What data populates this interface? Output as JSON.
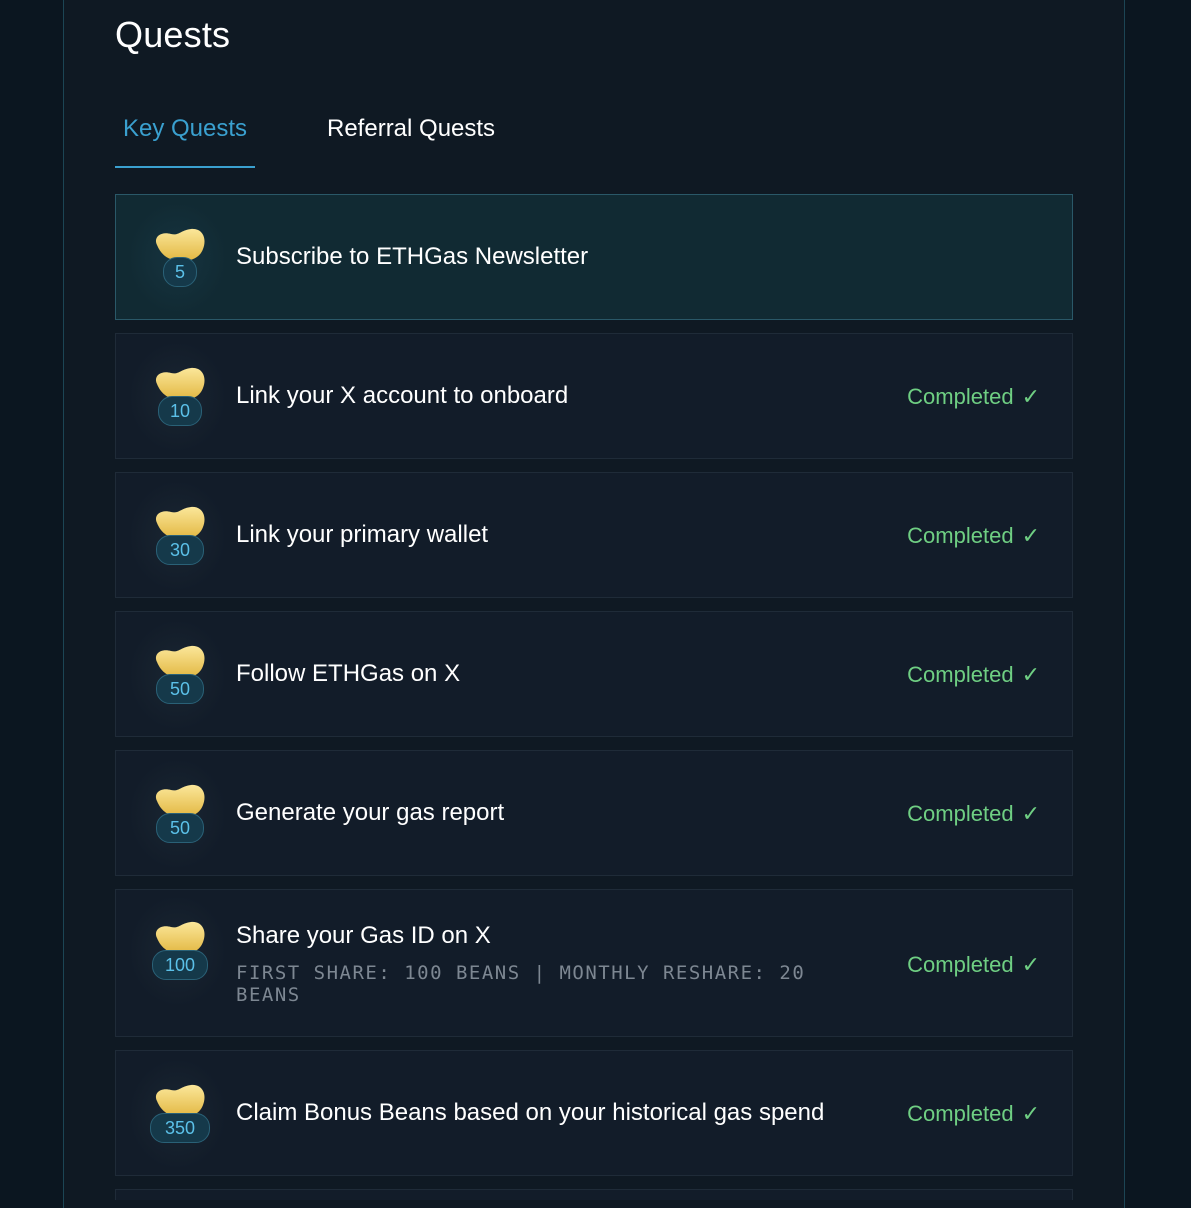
{
  "page_title": "Quests",
  "tabs": [
    {
      "label": "Key Quests",
      "active": true
    },
    {
      "label": "Referral Quests",
      "active": false
    }
  ],
  "colors": {
    "accent": "#3aa0cf",
    "completed": "#6fcf83",
    "bean": "#f3d26a"
  },
  "quests": [
    {
      "points": "5",
      "title": "Subscribe to ETHGas Newsletter",
      "subtitle": "",
      "status": ""
    },
    {
      "points": "10",
      "title": "Link your X account to onboard",
      "subtitle": "",
      "status": "Completed"
    },
    {
      "points": "30",
      "title": "Link your primary wallet",
      "subtitle": "",
      "status": "Completed"
    },
    {
      "points": "50",
      "title": "Follow ETHGas on X",
      "subtitle": "",
      "status": "Completed"
    },
    {
      "points": "50",
      "title": "Generate your gas report",
      "subtitle": "",
      "status": "Completed"
    },
    {
      "points": "100",
      "title": "Share your Gas ID on X",
      "subtitle": "FIRST SHARE: 100 BEANS | MONTHLY RESHARE: 20 BEANS",
      "status": "Completed"
    },
    {
      "points": "350",
      "title": "Claim Bonus Beans based on your historical gas spend",
      "subtitle": "",
      "status": "Completed"
    }
  ],
  "icons": {
    "bean": "bean-icon",
    "check": "checkmark-icon"
  },
  "check_glyph": "✓"
}
